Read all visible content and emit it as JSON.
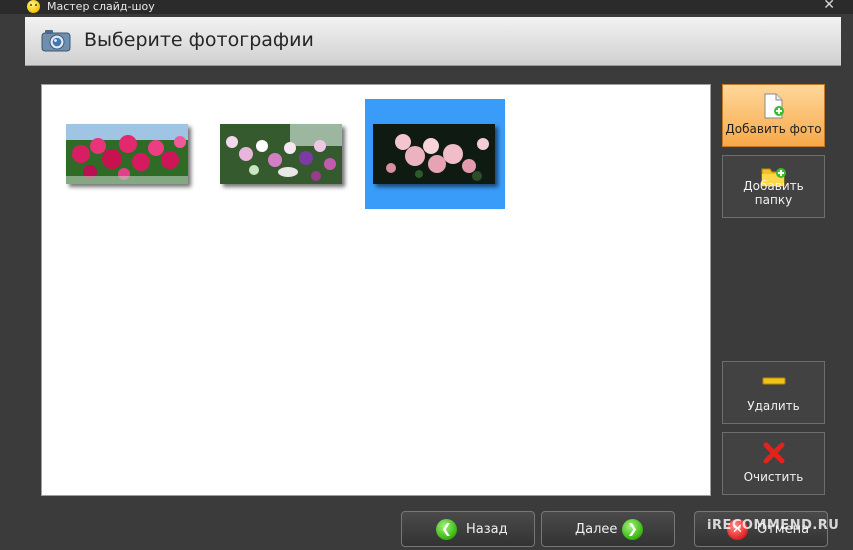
{
  "window": {
    "title": "Мастер слайд-шоу",
    "close_glyph": "✕"
  },
  "header": {
    "title": "Выберите фотографии",
    "icon": "camera-icon"
  },
  "gallery": {
    "photos": [
      {
        "alt": "pink-roses-photo",
        "selected": false
      },
      {
        "alt": "flower-pots-photo",
        "selected": false
      },
      {
        "alt": "pale-pink-roses-photo",
        "selected": true
      }
    ]
  },
  "sidebar": {
    "add_photo": "Добавить фото",
    "add_folder": "Добавить папку",
    "delete": "Удалить",
    "clear": "Очистить"
  },
  "footer": {
    "back": "Назад",
    "next": "Далее",
    "cancel": "Отмена",
    "watermark": "iRECOMMEND.RU"
  },
  "colors": {
    "selection": "#3a9cf9",
    "active_button": "#f7a94a",
    "nav_icon": "#33b40c"
  }
}
